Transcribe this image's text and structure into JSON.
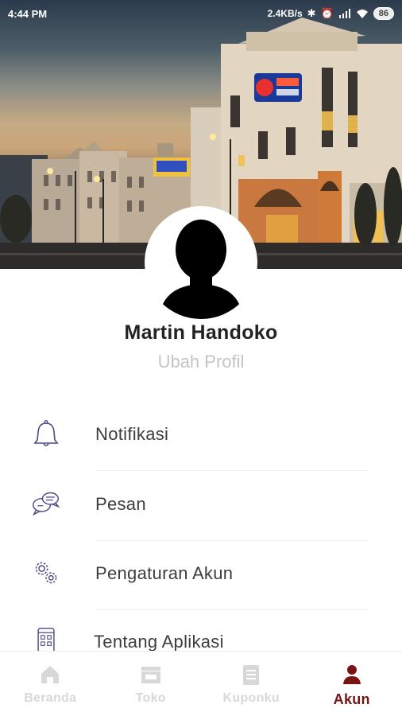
{
  "status_bar": {
    "time": "4:44 PM",
    "network_speed": "2.4KB/s",
    "battery": "86",
    "icons": [
      "bluetooth-off-icon",
      "alarm-icon",
      "signal-icon",
      "wifi-icon",
      "battery-icon"
    ]
  },
  "profile": {
    "name": "Martin Handoko",
    "edit_label": "Ubah Profil"
  },
  "menu": {
    "items": [
      {
        "label": "Notifikasi",
        "icon": "bell-icon"
      },
      {
        "label": "Pesan",
        "icon": "chat-bubbles-icon"
      },
      {
        "label": "Pengaturan Akun",
        "icon": "gears-icon"
      },
      {
        "label": "Tentang Aplikasi",
        "icon": "phone-app-icon"
      }
    ]
  },
  "bottom_nav": {
    "tabs": [
      {
        "label": "Beranda",
        "icon": "home-icon",
        "active": false
      },
      {
        "label": "Toko",
        "icon": "store-icon",
        "active": false
      },
      {
        "label": "Kuponku",
        "icon": "coupon-icon",
        "active": false
      },
      {
        "label": "Akun",
        "icon": "person-icon",
        "active": true
      }
    ]
  },
  "colors": {
    "accent": "#7a1414",
    "icon_line": "#4a4a8a",
    "inactive_nav": "#d8d8d8",
    "muted_text": "#c4c4c4"
  }
}
